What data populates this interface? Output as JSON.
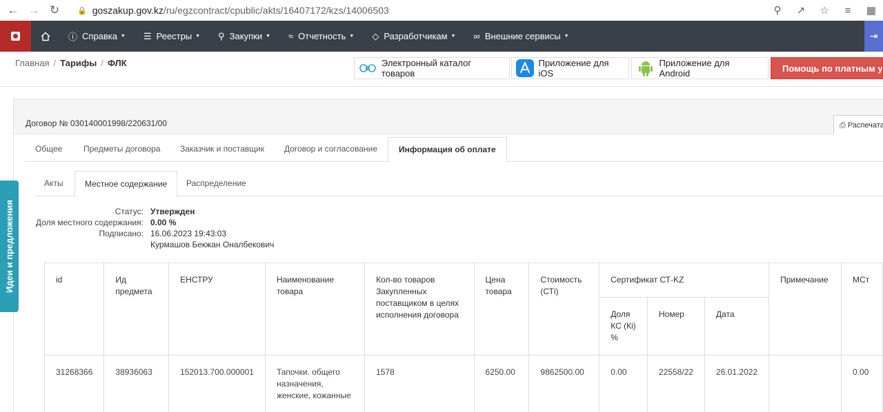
{
  "browser": {
    "url_host": "goszakup.gov.kz",
    "url_path": "/ru/egzcontract/cpublic/akts/16407172/kzs/14006503"
  },
  "navbar": {
    "items": [
      {
        "label": "Справка",
        "icon": "question-circle-icon"
      },
      {
        "label": "Реестры",
        "icon": "layers-icon"
      },
      {
        "label": "Закупки",
        "icon": "search-icon"
      },
      {
        "label": "Отчетность",
        "icon": "chart-line-icon"
      },
      {
        "label": "Разработчикам",
        "icon": "tag-icon"
      },
      {
        "label": "Внешние сервисы",
        "icon": "link-icon"
      }
    ]
  },
  "breadcrumb": {
    "home": "Главная",
    "tariffs": "Тарифы",
    "current": "ФЛК"
  },
  "top_buttons": {
    "catalog": "Электронный каталог товаров",
    "ios": "Приложение для iOS",
    "android": "Приложение для Android",
    "help": "Помощь по платным усл"
  },
  "contract": {
    "title": "Договор № 030140001998/220631/00",
    "print": "Распечата"
  },
  "tabs": [
    "Общее",
    "Предметы договора",
    "Заказчик и поставщик",
    "Договор и согласование",
    "Информация об оплате"
  ],
  "subtabs": [
    "Акты",
    "Местное содержание",
    "Распределение"
  ],
  "info": {
    "status_label": "Статус:",
    "status_value": "Утвержден",
    "share_label": "Доля местного содержания:",
    "share_value": "0.00 %",
    "signed_label": "Подписано:",
    "signed_value": "16.06.2023 19:43:03",
    "signer": "Курмашов Бекжан Оналбекович"
  },
  "table": {
    "headers": {
      "id": "id",
      "item_id": "Ид предмета",
      "enstru": "ЕНСТРУ",
      "name": "Наименование товара",
      "qty": "Кол-во товаров Закупленных поставщиком в целях исполнения договора",
      "price": "Цена товара",
      "cost": "Стоимость (СТі)",
      "cert": "Сертификат СТ-KZ",
      "ks_share": "Доля КС (Кі) %",
      "number": "Номер",
      "date": "Дата",
      "note": "Примечание",
      "mst": "МСт"
    },
    "row": {
      "id": "31268366",
      "item_id": "38936063",
      "enstru": "152013.700.000001",
      "name": "Тапочки. общего назначения, женские, кожанные",
      "qty": "1578",
      "price": "6250.00",
      "cost": "9862500.00",
      "ks_share": "0.00",
      "number": "22558/22",
      "date": "26.01.2022",
      "note": "",
      "mst": "0.00"
    }
  },
  "side_tab": "Идеи и предложения"
}
